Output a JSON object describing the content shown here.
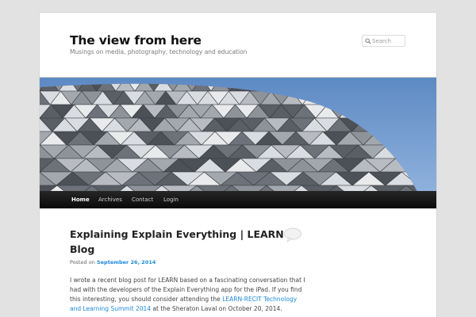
{
  "header": {
    "site_title": "The view from here",
    "site_description": "Musings on media, photography, technology and education"
  },
  "search": {
    "placeholder": "Search",
    "icon": "search-icon"
  },
  "banner": {
    "description_icon": "geodesic-dome-photo"
  },
  "nav": {
    "items": [
      {
        "label": "Home",
        "active": true
      },
      {
        "label": "Archives"
      },
      {
        "label": "Contact"
      },
      {
        "label": "Login"
      }
    ]
  },
  "post": {
    "title": "Explaining Explain Everything | LEARN Blog",
    "meta_prefix": "Posted on",
    "date": "September 26, 2014",
    "body_1": "I wrote a recent blog post for LEARN based on a fascinating conversation that I had with the developers of the Explain Everything app for the iPad. If you find this interesting, you should consider attending the ",
    "link_text": "LEARN-RECIT Technology and Learning Summit 2014",
    "body_2": " at the Sheraton Laval on October 20, 2014."
  },
  "colors": {
    "accent_link": "#1b8be0",
    "nav_bg": "#1a1a1a",
    "page_bg": "#e2e2e2"
  }
}
